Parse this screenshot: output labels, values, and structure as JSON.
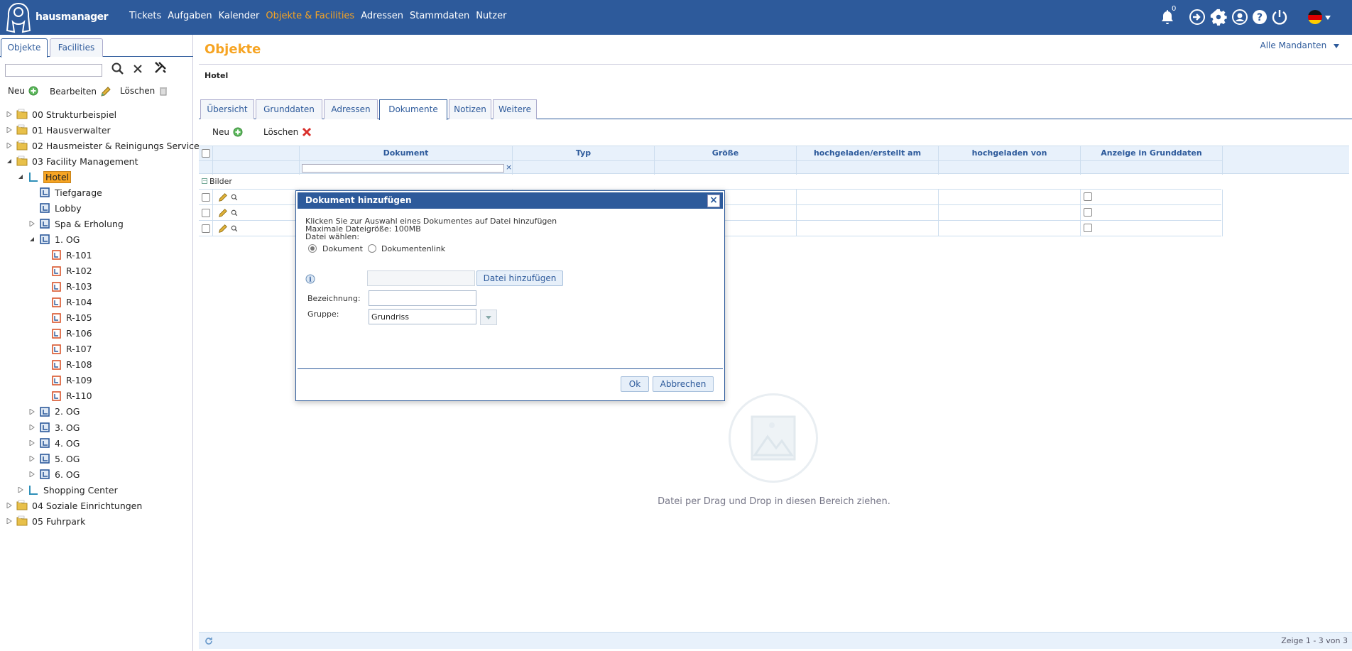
{
  "app": {
    "logo_text": "hausmanager"
  },
  "nav": {
    "items": [
      "Tickets",
      "Aufgaben",
      "Kalender",
      "Objekte & Facilities",
      "Adressen",
      "Stammdaten",
      "Nutzer"
    ],
    "active": "Objekte & Facilities"
  },
  "top_icons": {
    "notification_count": "0",
    "icons": [
      "bell-icon",
      "login-icon",
      "gear-icon",
      "user-icon",
      "help-icon",
      "power-icon",
      "flag-de-icon"
    ]
  },
  "left": {
    "tabs": [
      "Objekte",
      "Facilities"
    ],
    "active_tab": "Objekte",
    "search_placeholder": "",
    "toolbar": {
      "neu": "Neu",
      "bearbeiten": "Bearbeiten",
      "loeschen": "Löschen"
    }
  },
  "tree": [
    {
      "label": "00 Strukturbeispiel",
      "type": "folder",
      "state": "collapsed"
    },
    {
      "label": "01 Hausverwalter",
      "type": "folder",
      "state": "collapsed"
    },
    {
      "label": "02 Hausmeister & Reinigungs Service",
      "type": "folder",
      "state": "collapsed"
    },
    {
      "label": "03 Facility Management",
      "type": "folder",
      "state": "expanded"
    },
    {
      "label": "Hotel",
      "type": "building",
      "state": "expanded",
      "selected": true
    },
    {
      "label": "Tiefgarage",
      "type": "floor",
      "state": "leaf"
    },
    {
      "label": "Lobby",
      "type": "floor",
      "state": "leaf"
    },
    {
      "label": "Spa & Erholung",
      "type": "floor",
      "state": "collapsed"
    },
    {
      "label": "1. OG",
      "type": "floor",
      "state": "expanded"
    },
    {
      "label": "R-101",
      "type": "room",
      "state": "leaf"
    },
    {
      "label": "R-102",
      "type": "room",
      "state": "leaf"
    },
    {
      "label": "R-103",
      "type": "room",
      "state": "leaf"
    },
    {
      "label": "R-104",
      "type": "room",
      "state": "leaf"
    },
    {
      "label": "R-105",
      "type": "room",
      "state": "leaf"
    },
    {
      "label": "R-106",
      "type": "room",
      "state": "leaf"
    },
    {
      "label": "R-107",
      "type": "room",
      "state": "leaf"
    },
    {
      "label": "R-108",
      "type": "room",
      "state": "leaf"
    },
    {
      "label": "R-109",
      "type": "room",
      "state": "leaf"
    },
    {
      "label": "R-110",
      "type": "room",
      "state": "leaf"
    },
    {
      "label": "2. OG",
      "type": "floor",
      "state": "collapsed"
    },
    {
      "label": "3. OG",
      "type": "floor",
      "state": "collapsed"
    },
    {
      "label": "4. OG",
      "type": "floor",
      "state": "collapsed"
    },
    {
      "label": "5. OG",
      "type": "floor",
      "state": "collapsed"
    },
    {
      "label": "6. OG",
      "type": "floor",
      "state": "collapsed"
    },
    {
      "label": "Shopping Center",
      "type": "building",
      "state": "collapsed"
    },
    {
      "label": "04 Soziale Einrichtungen",
      "type": "folder",
      "state": "collapsed"
    },
    {
      "label": "05 Fuhrpark",
      "type": "folder",
      "state": "collapsed"
    }
  ],
  "content": {
    "title": "Objekte",
    "mandant": "Alle Mandanten",
    "object_name": "Hotel",
    "tabs": [
      "Übersicht",
      "Grunddaten",
      "Adressen",
      "Dokumente",
      "Notizen",
      "Weitere"
    ],
    "active_tab": "Dokumente",
    "toolbar": {
      "neu": "Neu",
      "loeschen": "Löschen"
    },
    "grid": {
      "columns": [
        "Dokument",
        "Typ",
        "Größe",
        "hochgeladen/erstellt am",
        "hochgeladen von",
        "Anzeige in Grunddaten"
      ],
      "filter_value": "",
      "group": "Bilder",
      "rows": [
        {},
        {},
        {}
      ]
    },
    "drop_text": "Datei per Drag und Drop in diesen Bereich ziehen.",
    "page_info": "Zeige 1 - 3 von 3"
  },
  "dialog": {
    "title": "Dokument hinzufügen",
    "line1": "Klicken Sie zur Auswahl eines Dokumentes auf Datei hinzufügen",
    "line2": "Maximale Dateigröße: 100MB",
    "line3": "Datei wählen:",
    "radio_dokument": "Dokument",
    "radio_link": "Dokumentenlink",
    "selected_radio": "Dokument",
    "file_value": "",
    "add_file_button": "Datei hinzufügen",
    "bezeichnung_label": "Bezeichnung:",
    "bezeichnung_value": "",
    "gruppe_label": "Gruppe:",
    "gruppe_value": "Grundriss",
    "ok_button": "Ok",
    "cancel_button": "Abbrechen"
  }
}
